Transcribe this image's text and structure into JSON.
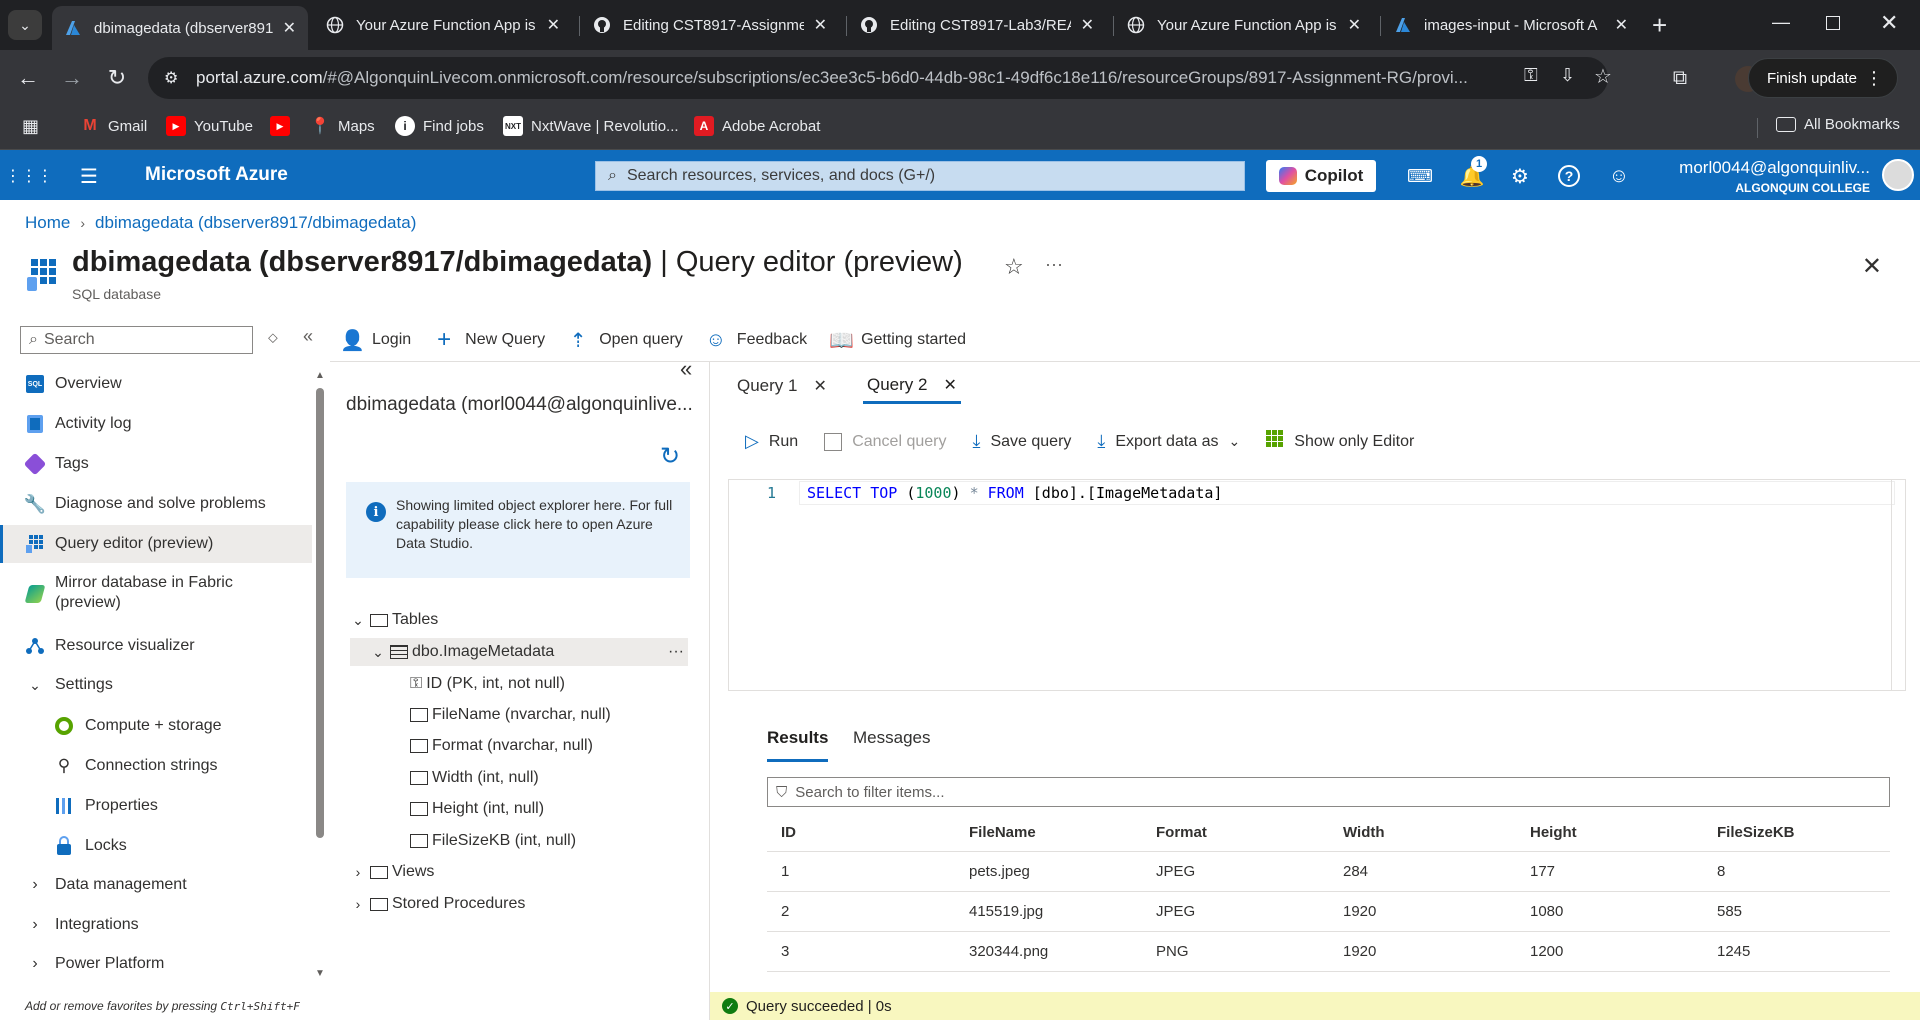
{
  "browser": {
    "tabs": [
      {
        "title": "dbimagedata (dbserver891",
        "icon": "azure-icon",
        "active": true
      },
      {
        "title": "Your Azure Function App is",
        "icon": "globe-icon"
      },
      {
        "title": "Editing CST8917-Assignme",
        "icon": "github-icon"
      },
      {
        "title": "Editing CST8917-Lab3/REA",
        "icon": "github-icon"
      },
      {
        "title": "Your Azure Function App is",
        "icon": "globe-icon"
      },
      {
        "title": "images-input - Microsoft A",
        "icon": "azure-icon"
      }
    ],
    "url_host": "portal.azure.com",
    "url_path": "/#@AlgonquinLivecom.onmicrosoft.com/resource/subscriptions/ec3ee3c5-b6d0-44db-98c1-49df6c18e116/resourceGroups/8917-Assignment-RG/provi...",
    "finish_update": "Finish update",
    "bookmarks": [
      {
        "label": "Gmail",
        "icon": "gmail-icon",
        "color": "#ea4335"
      },
      {
        "label": "YouTube",
        "icon": "youtube-icon",
        "color": "#ff0000"
      },
      {
        "label": "",
        "icon": "youtube-icon",
        "color": "#ff0000"
      },
      {
        "label": "Maps",
        "icon": "maps-icon",
        "color": "#34a853"
      },
      {
        "label": "Find jobs",
        "icon": "info-icon",
        "color": "#ffffff"
      },
      {
        "label": "NxtWave | Revolutio...",
        "icon": "nxtwave-icon",
        "color": "#ffffff"
      },
      {
        "label": "Adobe Acrobat",
        "icon": "acrobat-icon",
        "color": "#e11b22"
      }
    ],
    "all_bookmarks": "All Bookmarks"
  },
  "azure": {
    "brand": "Microsoft Azure",
    "search_placeholder": "Search resources, services, and docs (G+/)",
    "copilot": "Copilot",
    "notification_count": "1",
    "account_name": "morl0044@algonquinliv...",
    "account_org": "ALGONQUIN COLLEGE"
  },
  "breadcrumb": {
    "home": "Home",
    "current": "dbimagedata (dbserver8917/dbimagedata)"
  },
  "title": {
    "main": "dbimagedata (dbserver8917/dbimagedata)",
    "suffix": " | Query editor (preview)",
    "subtitle": "SQL database"
  },
  "nav": {
    "search_placeholder": "Search",
    "items": [
      {
        "label": "Overview",
        "icon": "sql-icon"
      },
      {
        "label": "Activity log",
        "icon": "activity-log-icon"
      },
      {
        "label": "Tags",
        "icon": "tag-icon"
      },
      {
        "label": "Diagnose and solve problems",
        "icon": "wrench-icon"
      },
      {
        "label": "Query editor (preview)",
        "icon": "query-editor-icon"
      },
      {
        "label": "Mirror database in Fabric",
        "label2": "(preview)",
        "icon": "fabric-icon"
      },
      {
        "label": "Resource visualizer",
        "icon": "visualizer-icon"
      },
      {
        "label": "Settings",
        "icon": "chevron-down-icon"
      },
      {
        "label": "Compute + storage",
        "icon": "compute-icon"
      },
      {
        "label": "Connection strings",
        "icon": "plug-icon"
      },
      {
        "label": "Properties",
        "icon": "properties-icon"
      },
      {
        "label": "Locks",
        "icon": "lock-icon"
      },
      {
        "label": "Data management",
        "icon": "chevron-right-icon"
      },
      {
        "label": "Integrations",
        "icon": "chevron-right-icon"
      },
      {
        "label": "Power Platform",
        "icon": "chevron-right-icon"
      }
    ],
    "favorites_hint_prefix": "Add or remove favorites by pressing ",
    "favorites_hint_keys": "Ctrl+Shift+F"
  },
  "commands": {
    "login": "Login",
    "new_query": "New Query",
    "open_query": "Open query",
    "feedback": "Feedback",
    "getting_started": "Getting started"
  },
  "explorer": {
    "connection": "dbimagedata (morl0044@algonquinlive...",
    "info": "Showing limited object explorer here. For full capability please click here to open Azure Data Studio.",
    "tables": "Tables",
    "table_name": "dbo.ImageMetadata",
    "more": "···",
    "columns": [
      "ID (PK, int, not null)",
      "FileName (nvarchar, null)",
      "Format (nvarchar, null)",
      "Width (int, null)",
      "Height (int, null)",
      "FileSizeKB (int, null)"
    ],
    "views": "Views",
    "procedures": "Stored Procedures"
  },
  "query": {
    "tabs": [
      "Query 1",
      "Query 2"
    ],
    "run": "Run",
    "cancel": "Cancel query",
    "save": "Save query",
    "export": "Export data as",
    "show_editor": "Show only Editor",
    "line_no": "1",
    "sql": {
      "select": "SELECT",
      "top": "TOP",
      "lp": " (",
      "n": "1000",
      "rp": ") ",
      "star": "*",
      "from": " FROM ",
      "target": "[dbo].[ImageMetadata]"
    }
  },
  "results": {
    "tabs": [
      "Results",
      "Messages"
    ],
    "filter_placeholder": "Search to filter items...",
    "headers": [
      "ID",
      "FileName",
      "Format",
      "Width",
      "Height",
      "FileSizeKB"
    ],
    "rows": [
      [
        "1",
        "pets.jpeg",
        "JPEG",
        "284",
        "177",
        "8"
      ],
      [
        "2",
        "415519.jpg",
        "JPEG",
        "1920",
        "1080",
        "585"
      ],
      [
        "3",
        "320344.png",
        "PNG",
        "1920",
        "1200",
        "1245"
      ]
    ],
    "status": "Query succeeded | 0s"
  }
}
